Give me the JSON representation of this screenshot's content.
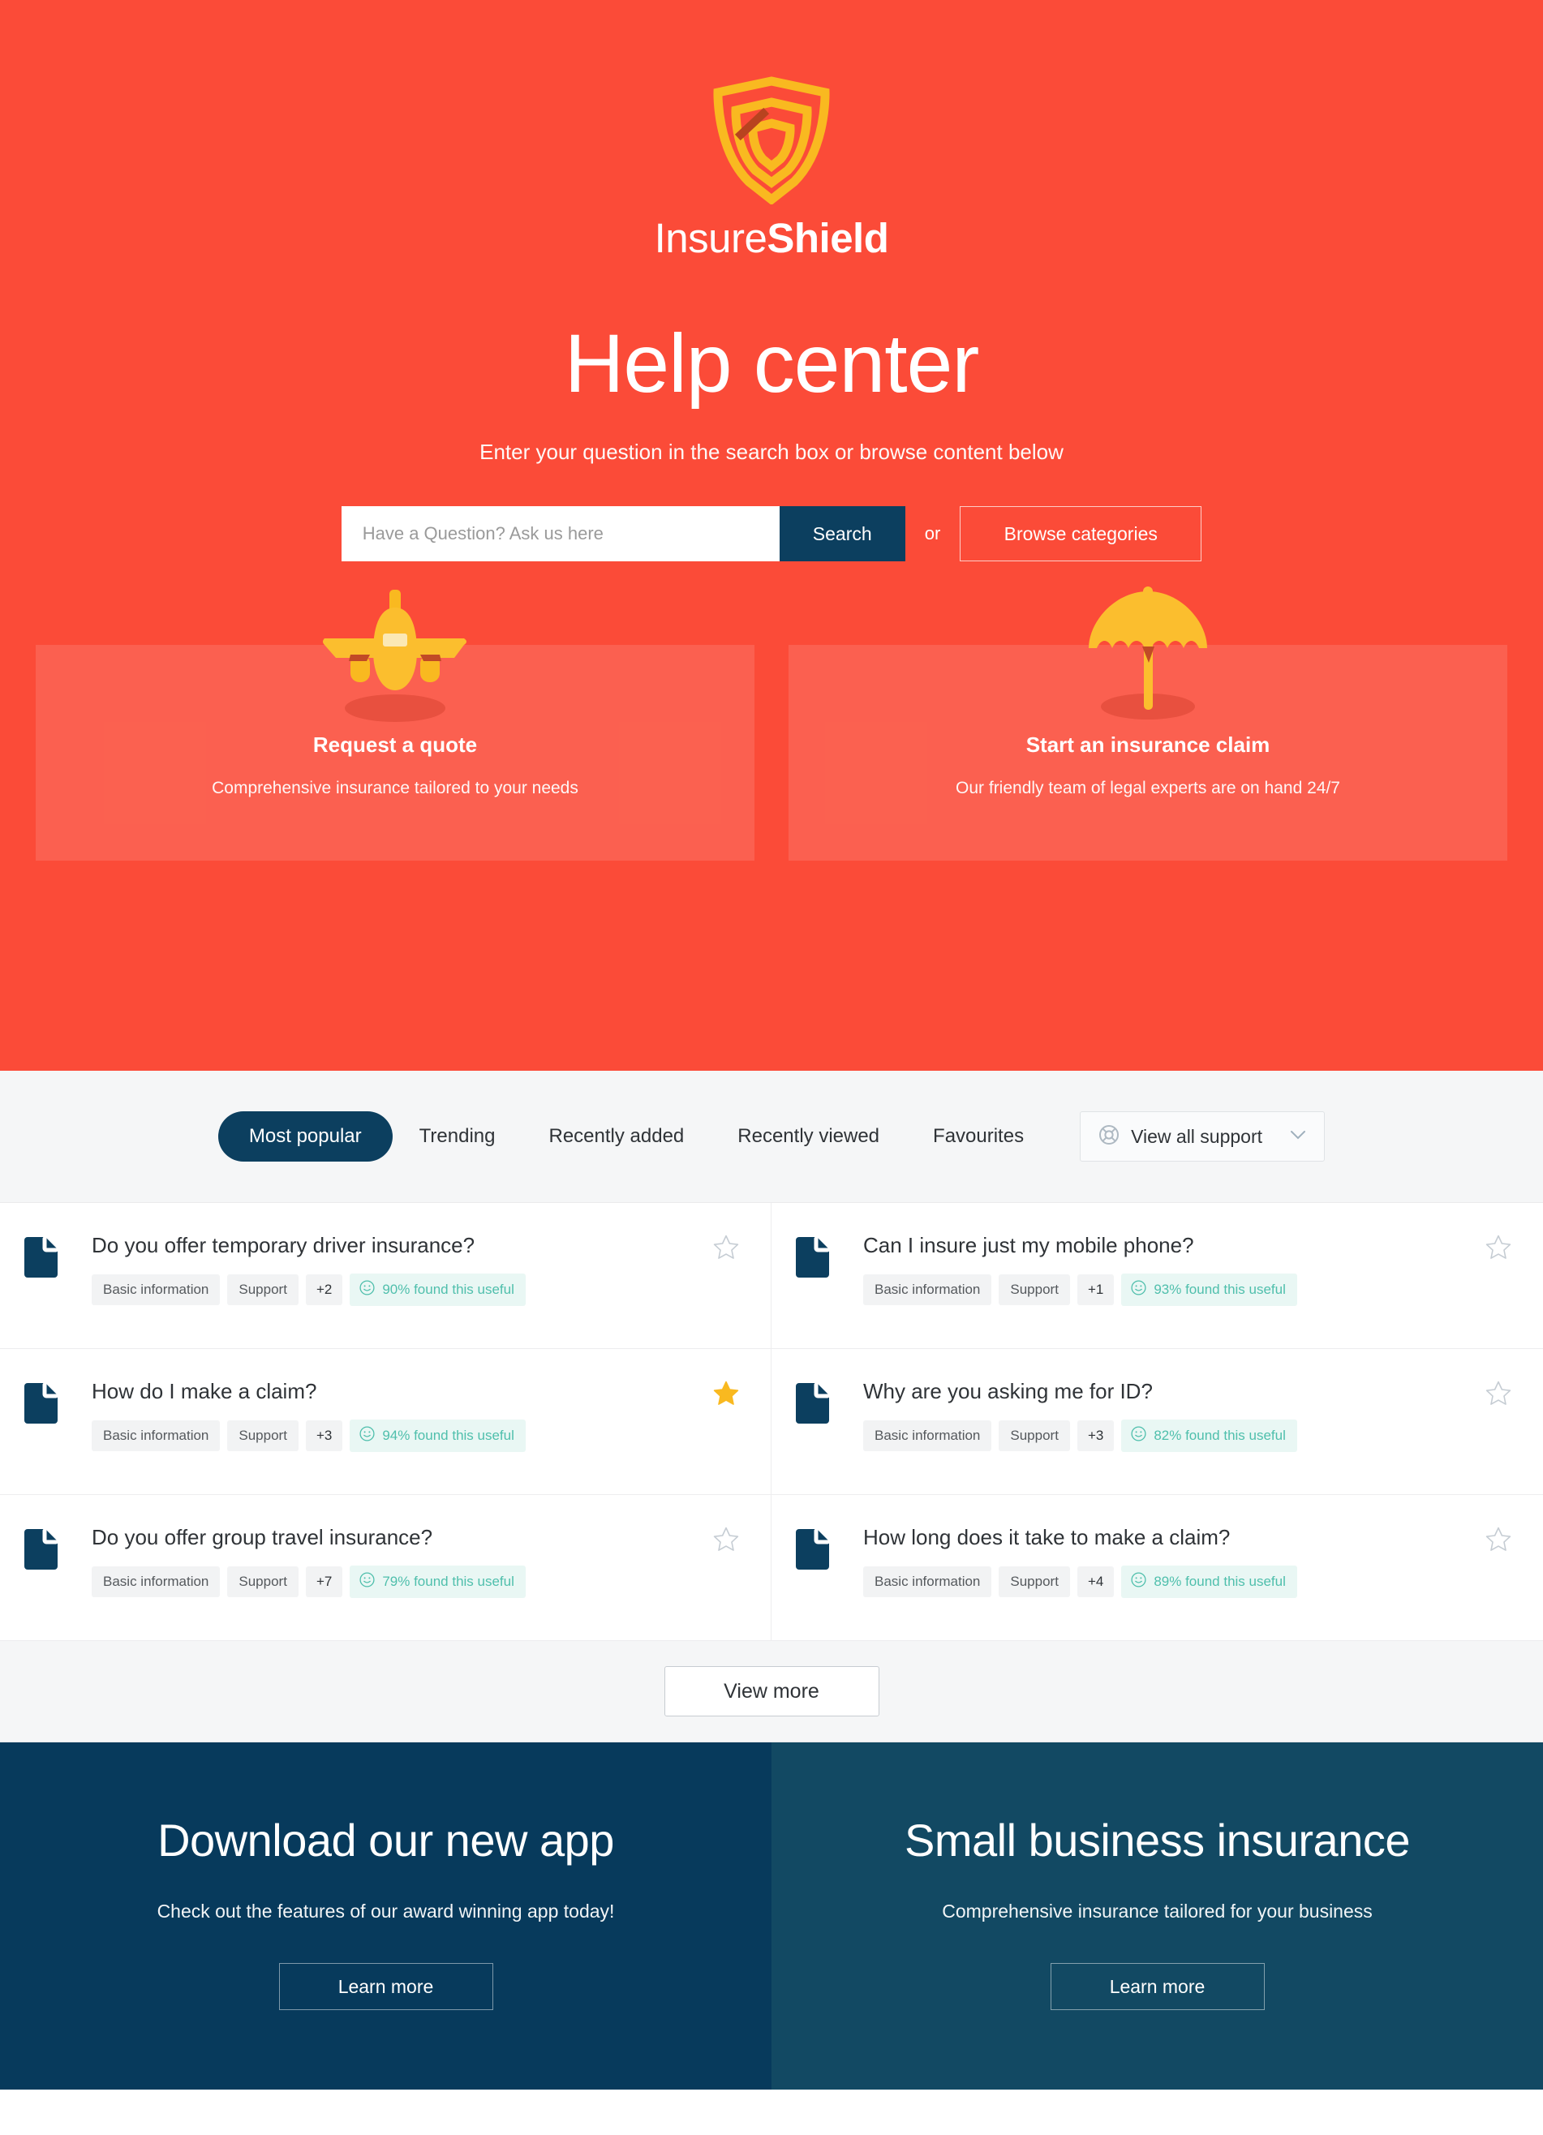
{
  "brand": {
    "name_light": "Insure",
    "name_bold": "Shield",
    "logo_icon": "shield-icon",
    "logo_color": "#F9B920"
  },
  "hero": {
    "title": "Help center",
    "subtitle": "Enter your question in the search box or browse content below",
    "background_color": "#FB4B38",
    "search": {
      "placeholder": "Have a Question? Ask us here",
      "value": "",
      "search_button": "Search",
      "or_label": "or",
      "browse_button": "Browse categories"
    },
    "promos": [
      {
        "icon": "airplane-icon",
        "title": "Request a quote",
        "description": "Comprehensive insurance tailored  to your needs"
      },
      {
        "icon": "umbrella-icon",
        "title": "Start an insurance claim",
        "description": "Our friendly team of legal experts are on hand 24/7"
      }
    ]
  },
  "tabs": [
    {
      "label": "Most popular",
      "active": true
    },
    {
      "label": "Trending",
      "active": false
    },
    {
      "label": "Recently added",
      "active": false
    },
    {
      "label": "Recently viewed",
      "active": false
    },
    {
      "label": "Favourites",
      "active": false
    }
  ],
  "view_all": {
    "icon": "lifebuoy-icon",
    "label": "View all support",
    "chevron": "chevron-down-icon"
  },
  "articles": [
    {
      "title": "Do you offer temporary driver insurance?",
      "tags": [
        "Basic information",
        "Support"
      ],
      "extra_count": "+2",
      "useful": "90% found this useful",
      "favourited": false
    },
    {
      "title": "Can I insure just my mobile phone?",
      "tags": [
        "Basic information",
        "Support"
      ],
      "extra_count": "+1",
      "useful": "93% found this useful",
      "favourited": false
    },
    {
      "title": "How do I make a claim?",
      "tags": [
        "Basic information",
        "Support"
      ],
      "extra_count": "+3",
      "useful": "94% found this useful",
      "favourited": true
    },
    {
      "title": "Why are you asking me for ID?",
      "tags": [
        "Basic information",
        "Support"
      ],
      "extra_count": "+3",
      "useful": "82% found this useful",
      "favourited": false
    },
    {
      "title": "Do you offer group travel insurance?",
      "tags": [
        "Basic information",
        "Support"
      ],
      "extra_count": "+7",
      "useful": "79% found this useful",
      "favourited": false
    },
    {
      "title": "How long does it take to make a claim?",
      "tags": [
        "Basic information",
        "Support"
      ],
      "extra_count": "+4",
      "useful": "89% found this useful",
      "favourited": false
    }
  ],
  "view_more_label": "View more",
  "footer_panels": [
    {
      "title": "Download our new app",
      "subtitle": "Check out the features of our award winning app today!",
      "button": "Learn more",
      "background_color": "#073A5C"
    },
    {
      "title": "Small business insurance",
      "subtitle": "Comprehensive insurance tailored for your business",
      "button": "Learn more",
      "background_color": "#124963"
    }
  ],
  "colors": {
    "brand_orange": "#FB4B38",
    "navy": "#0C3F5F",
    "gold": "#F9B920",
    "teal": "#4FBFAC",
    "band_grey": "#F5F6F7"
  }
}
